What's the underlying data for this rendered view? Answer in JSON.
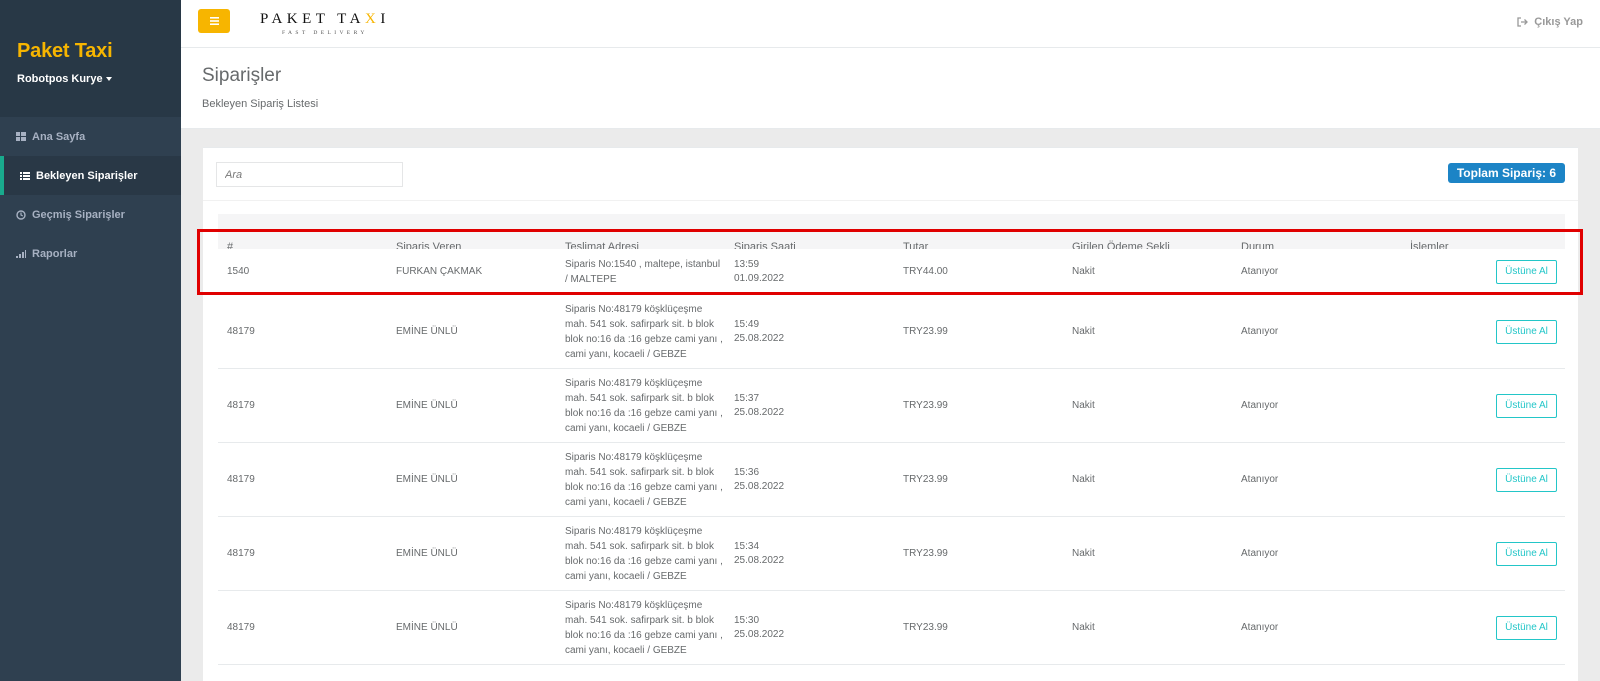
{
  "sidebar": {
    "brand": "Paket Taxi",
    "user": "Robotpos Kurye",
    "items": [
      {
        "label": "Ana Sayfa",
        "icon": "dashboard-icon"
      },
      {
        "label": "Bekleyen Siparişler",
        "icon": "list-icon",
        "active": true
      },
      {
        "label": "Geçmiş Siparişler",
        "icon": "clock-icon"
      },
      {
        "label": "Raporlar",
        "icon": "bar-chart-icon"
      }
    ]
  },
  "topbar": {
    "logo_main": "PAKET TA",
    "logo_x": "X",
    "logo_end": "I",
    "logo_sub": "FAST DELIVERY",
    "logout": "Çıkış Yap"
  },
  "page": {
    "title": "Siparişler",
    "subtitle": "Bekleyen Sipariş Listesi"
  },
  "search": {
    "placeholder": "Ara"
  },
  "total": "Toplam Sipariş: 6",
  "table": {
    "headers": [
      "#",
      "Sipariş Veren",
      "Teslimat Adresi",
      "Sipariş Saati",
      "Tutar",
      "Girilen Ödeme Şekli",
      "Durum",
      "İşlemler"
    ],
    "rows": [
      {
        "id": "1540",
        "customer": "FURKAN ÇAKMAK",
        "address": "Siparis No:1540 , maltepe, istanbul / MALTEPE",
        "time": "13:59",
        "date": "01.09.2022",
        "amount": "TRY44.00",
        "payment": "Nakit",
        "status": "Atanıyor",
        "action": "Üstüne Al"
      },
      {
        "id": "48179",
        "customer": "EMİNE ÜNLÜ",
        "address": "Siparis No:48179 köşklüçeşme mah. 541 sok. safirpark sit. b blok blok no:16 da :16 gebze cami yanı , cami yanı, kocaeli / GEBZE",
        "time": "15:49",
        "date": "25.08.2022",
        "amount": "TRY23.99",
        "payment": "Nakit",
        "status": "Atanıyor",
        "action": "Üstüne Al"
      },
      {
        "id": "48179",
        "customer": "EMİNE ÜNLÜ",
        "address": "Siparis No:48179 köşklüçeşme mah. 541 sok. safirpark sit. b blok blok no:16 da :16 gebze cami yanı , cami yanı, kocaeli / GEBZE",
        "time": "15:37",
        "date": "25.08.2022",
        "amount": "TRY23.99",
        "payment": "Nakit",
        "status": "Atanıyor",
        "action": "Üstüne Al"
      },
      {
        "id": "48179",
        "customer": "EMİNE ÜNLÜ",
        "address": "Siparis No:48179 köşklüçeşme mah. 541 sok. safirpark sit. b blok blok no:16 da :16 gebze cami yanı , cami yanı, kocaeli / GEBZE",
        "time": "15:36",
        "date": "25.08.2022",
        "amount": "TRY23.99",
        "payment": "Nakit",
        "status": "Atanıyor",
        "action": "Üstüne Al"
      },
      {
        "id": "48179",
        "customer": "EMİNE ÜNLÜ",
        "address": "Siparis No:48179 köşklüçeşme mah. 541 sok. safirpark sit. b blok blok no:16 da :16 gebze cami yanı , cami yanı, kocaeli / GEBZE",
        "time": "15:34",
        "date": "25.08.2022",
        "amount": "TRY23.99",
        "payment": "Nakit",
        "status": "Atanıyor",
        "action": "Üstüne Al"
      },
      {
        "id": "48179",
        "customer": "EMİNE ÜNLÜ",
        "address": "Siparis No:48179 köşklüçeşme mah. 541 sok. safirpark sit. b blok blok no:16 da :16 gebze cami yanı , cami yanı, kocaeli / GEBZE",
        "time": "15:30",
        "date": "25.08.2022",
        "amount": "TRY23.99",
        "payment": "Nakit",
        "status": "Atanıyor",
        "action": "Üstüne Al"
      }
    ]
  },
  "colors": {
    "brand": "#f7b500",
    "sidebar": "#2f4050",
    "badge": "#1c84c6",
    "action": "#23c6c8",
    "highlight": "#e00000"
  }
}
